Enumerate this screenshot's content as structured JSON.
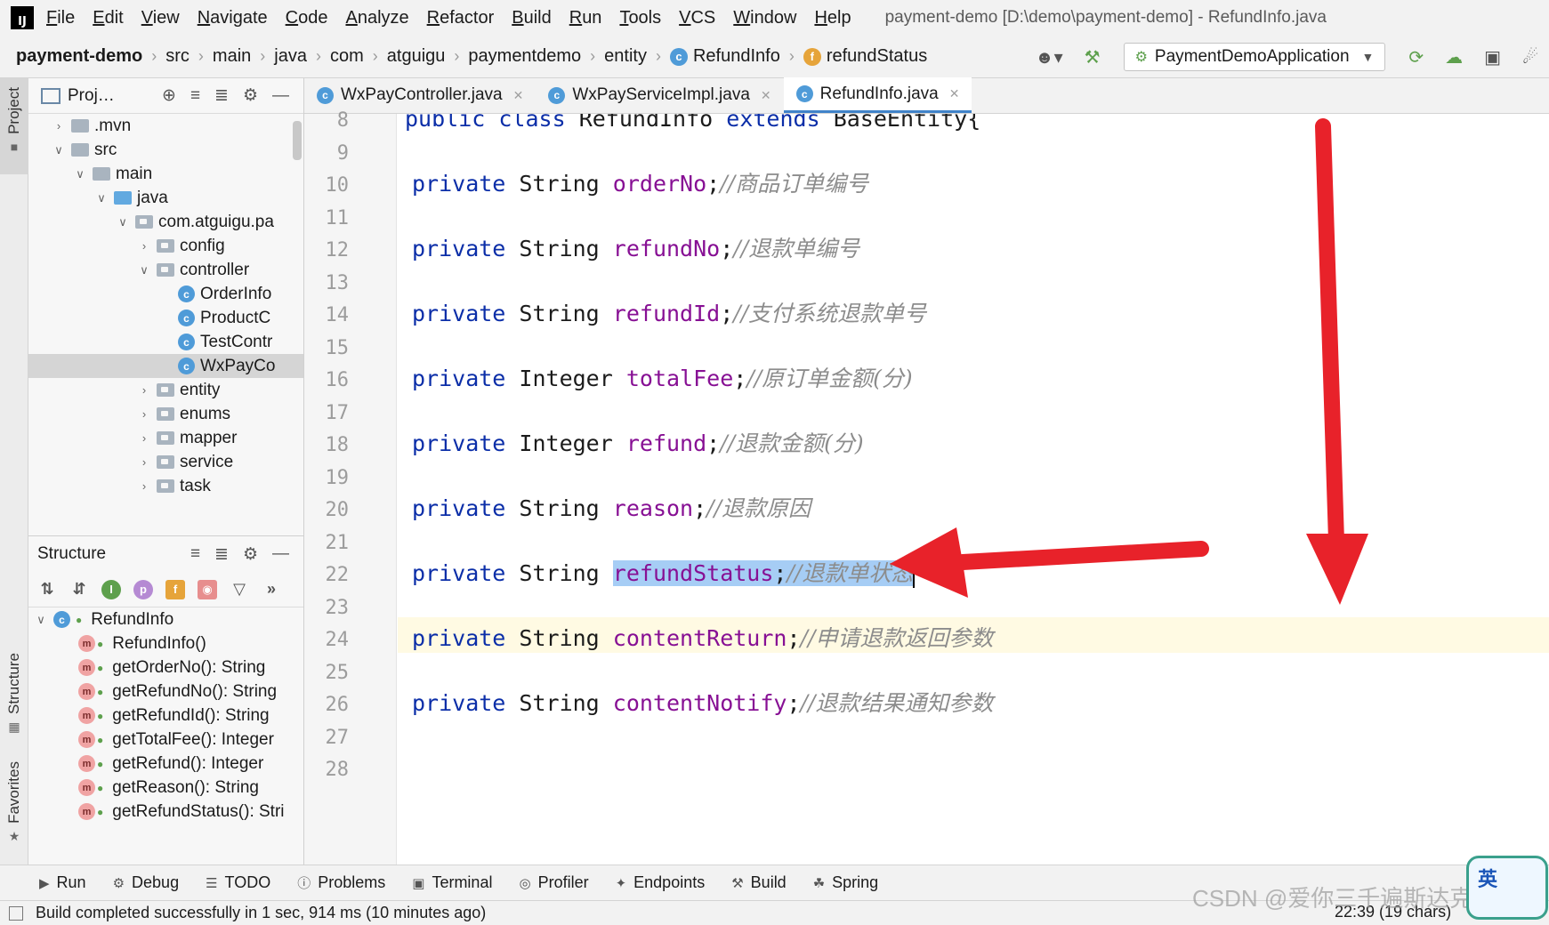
{
  "menubar": {
    "logo": "IJ",
    "items": [
      "File",
      "Edit",
      "View",
      "Navigate",
      "Code",
      "Analyze",
      "Refactor",
      "Build",
      "Run",
      "Tools",
      "VCS",
      "Window",
      "Help"
    ],
    "window_title": "payment-demo [D:\\demo\\payment-demo] - RefundInfo.java"
  },
  "navbar": {
    "crumbs": [
      "payment-demo",
      "src",
      "main",
      "java",
      "com",
      "atguigu",
      "paymentdemo",
      "entity",
      "RefundInfo",
      "refundStatus"
    ],
    "run_config": "PaymentDemoApplication"
  },
  "left_strip": {
    "project": "Project",
    "structure": "Structure",
    "favorites": "Favorites"
  },
  "project_panel": {
    "title": "Proj…",
    "tree": [
      {
        "label": ".mvn",
        "depth": 0,
        "arrow": "right",
        "icon": "folder"
      },
      {
        "label": "src",
        "depth": 0,
        "arrow": "down",
        "icon": "folder"
      },
      {
        "label": "main",
        "depth": 1,
        "arrow": "down",
        "icon": "folder"
      },
      {
        "label": "java",
        "depth": 2,
        "arrow": "down",
        "icon": "folder-blue"
      },
      {
        "label": "com.atguigu.pa",
        "depth": 3,
        "arrow": "down",
        "icon": "package"
      },
      {
        "label": "config",
        "depth": 4,
        "arrow": "right",
        "icon": "package"
      },
      {
        "label": "controller",
        "depth": 4,
        "arrow": "down",
        "icon": "package"
      },
      {
        "label": "OrderInfo",
        "depth": 5,
        "arrow": "",
        "icon": "class"
      },
      {
        "label": "ProductC",
        "depth": 5,
        "arrow": "",
        "icon": "class"
      },
      {
        "label": "TestContr",
        "depth": 5,
        "arrow": "",
        "icon": "class"
      },
      {
        "label": "WxPayCo",
        "depth": 5,
        "arrow": "",
        "icon": "class",
        "selected": true
      },
      {
        "label": "entity",
        "depth": 4,
        "arrow": "right",
        "icon": "package"
      },
      {
        "label": "enums",
        "depth": 4,
        "arrow": "right",
        "icon": "package"
      },
      {
        "label": "mapper",
        "depth": 4,
        "arrow": "right",
        "icon": "package"
      },
      {
        "label": "service",
        "depth": 4,
        "arrow": "right",
        "icon": "package"
      },
      {
        "label": "task",
        "depth": 4,
        "arrow": "right",
        "icon": "package"
      }
    ]
  },
  "structure_panel": {
    "title": "Structure",
    "root": "RefundInfo",
    "members": [
      "RefundInfo()",
      "getOrderNo(): String",
      "getRefundNo(): String",
      "getRefundId(): String",
      "getTotalFee(): Integer",
      "getRefund(): Integer",
      "getReason(): String",
      "getRefundStatus(): Stri"
    ]
  },
  "editor": {
    "tabs": [
      {
        "label": "WxPayController.java",
        "active": false
      },
      {
        "label": "WxPayServiceImpl.java",
        "active": false
      },
      {
        "label": "RefundInfo.java",
        "active": true
      }
    ],
    "line_numbers": [
      "8",
      "9",
      "10",
      "11",
      "12",
      "13",
      "14",
      "15",
      "16",
      "17",
      "18",
      "19",
      "20",
      "21",
      "22",
      "23",
      "24",
      "25",
      "26",
      "27",
      "28"
    ],
    "class_decl": {
      "kw1": "public",
      "kw2": "class",
      "name": "RefundInfo",
      "kw3": "extends",
      "base": "BaseEntity{"
    },
    "fields": [
      {
        "mod": "private",
        "type": "String",
        "name": "orderNo",
        "comment": "//商品订单编号"
      },
      {
        "mod": "private",
        "type": "String",
        "name": "refundNo",
        "comment": "//退款单编号"
      },
      {
        "mod": "private",
        "type": "String",
        "name": "refundId",
        "comment": "//支付系统退款单号"
      },
      {
        "mod": "private",
        "type": "Integer",
        "name": "totalFee",
        "comment": "//原订单金额(分)"
      },
      {
        "mod": "private",
        "type": "Integer",
        "name": "refund",
        "comment": "//退款金额(分)"
      },
      {
        "mod": "private",
        "type": "String",
        "name": "reason",
        "comment": "//退款原因"
      },
      {
        "mod": "private",
        "type": "String",
        "name": "refundStatus",
        "comment": "//退款单状态",
        "selected": true
      },
      {
        "mod": "private",
        "type": "String",
        "name": "contentReturn",
        "comment": "//申请退款返回参数"
      },
      {
        "mod": "private",
        "type": "String",
        "name": "contentNotify",
        "comment": "//退款结果通知参数"
      }
    ],
    "closing": "}"
  },
  "annotations": {
    "arrow_color": "#e8222a"
  },
  "bottom_tabs": [
    "Run",
    "Debug",
    "TODO",
    "Problems",
    "Terminal",
    "Profiler",
    "Endpoints",
    "Build",
    "Spring"
  ],
  "status_bar": {
    "text": "Build completed successfully in 1 sec, 914 ms (10 minutes ago)",
    "position": "22:39 (19 chars)"
  },
  "watermark": "CSDN @爱你三千遍斯达克",
  "ime": "英"
}
